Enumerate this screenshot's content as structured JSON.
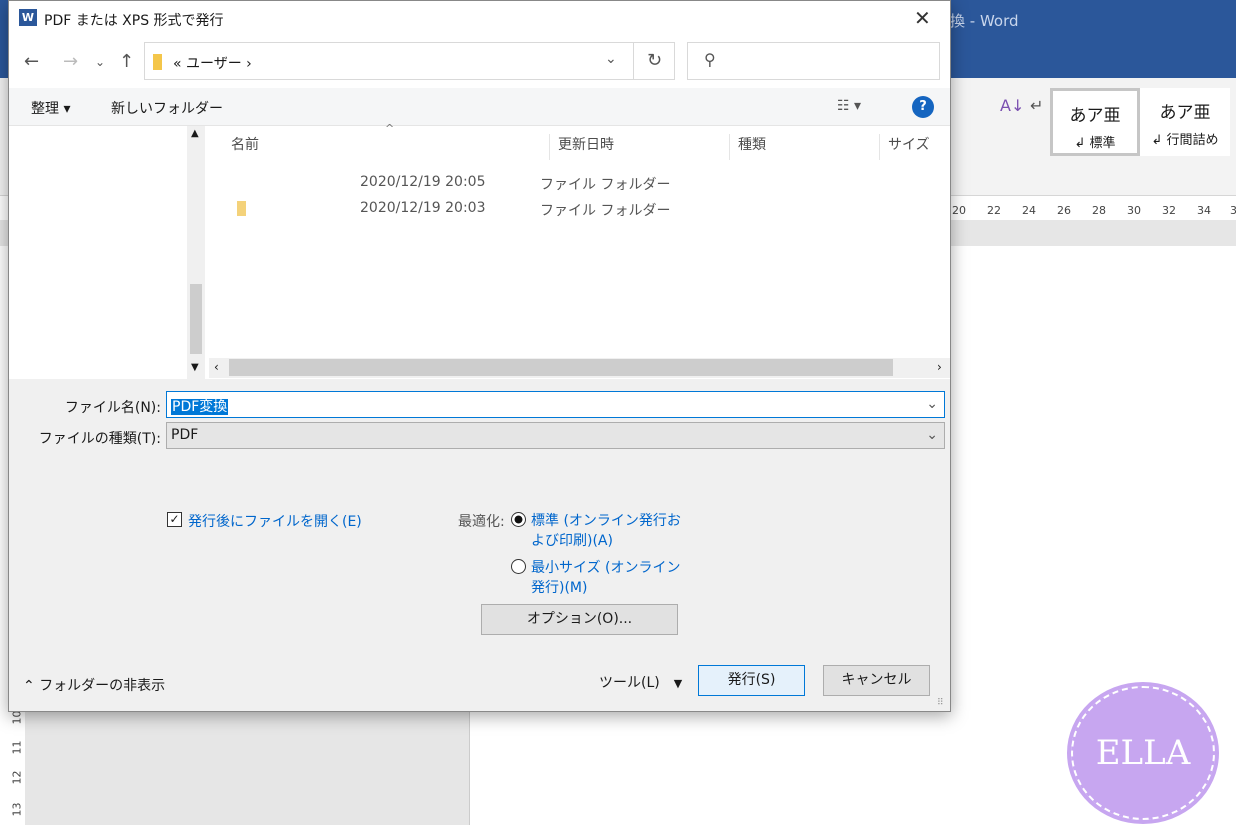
{
  "word": {
    "title": "換 - Word",
    "styles": [
      {
        "sample": "あア亜",
        "name": "↲ 標準"
      },
      {
        "sample": "あア亜",
        "name": "↲ 行間詰め"
      }
    ],
    "ruler": [
      "20",
      "22",
      "24",
      "26",
      "28",
      "30",
      "32",
      "34",
      "3"
    ],
    "vruler": [
      "10",
      "11",
      "12",
      "13"
    ]
  },
  "dialog": {
    "title": "PDF または XPS 形式で発行",
    "app_icon": "W",
    "address": "« ユーザー ›",
    "search_placeholder": "",
    "toolbar": {
      "organize": "整理 ▾",
      "new_folder": "新しいフォルダー"
    },
    "columns": [
      "名前",
      "更新日時",
      "種類",
      "サイズ"
    ],
    "rows": [
      {
        "name": "",
        "modified": "2020/12/19 20:05",
        "type": "ファイル フォルダー"
      },
      {
        "name": "",
        "modified": "2020/12/19 20:03",
        "type": "ファイル フォルダー"
      }
    ],
    "filename_label": "ファイル名(N):",
    "filename_value": "PDF変換",
    "filetype_label": "ファイルの種類(T):",
    "filetype_value": "PDF",
    "open_after_label": "発行後にファイルを開く(E)",
    "open_after_checked": true,
    "optimize_label": "最適化:",
    "optimize_options": [
      {
        "label": "標準 (オンライン発行および印刷)(A)",
        "selected": true
      },
      {
        "label": "最小サイズ (オンライン発行)(M)",
        "selected": false
      }
    ],
    "options_button": "オプション(O)...",
    "hide_folders": "フォルダーの非表示",
    "tools": "ツール(L)",
    "publish": "発行(S)",
    "cancel": "キャンセル"
  },
  "watermark": "ELLA",
  "colors": {
    "word_blue": "#2b579a",
    "accent": "#0078d7",
    "link": "#0066cc",
    "watermark": "#c7a6f0"
  }
}
